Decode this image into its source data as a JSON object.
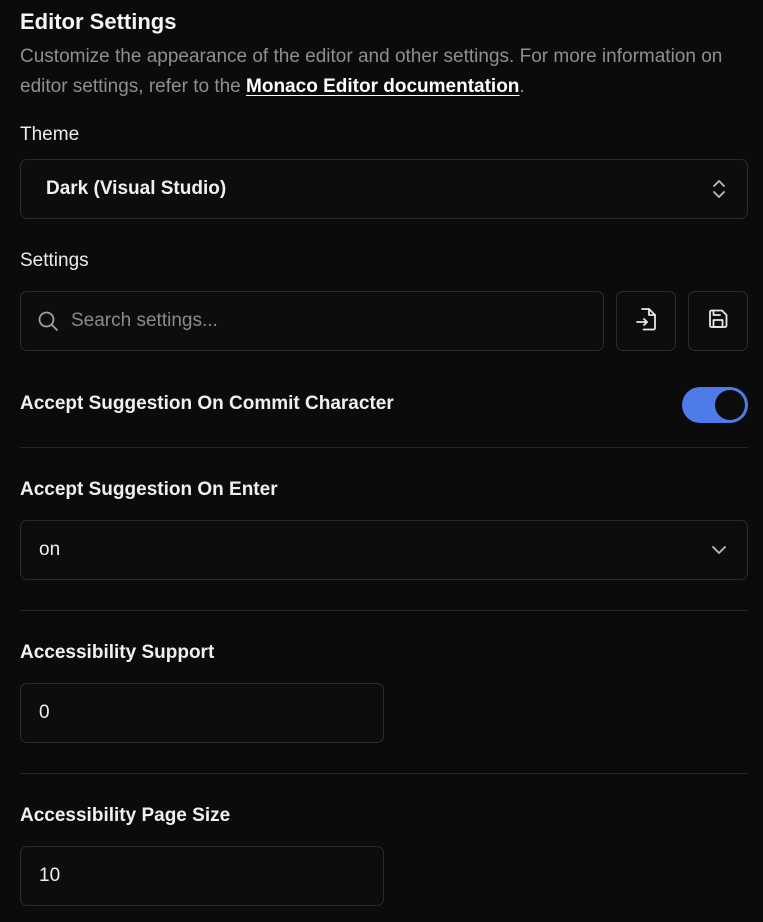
{
  "header": {
    "title": "Editor Settings",
    "description": "Customize the appearance of the editor and other settings. For more information on editor settings, refer to the ",
    "link_text": "Monaco Editor documentation",
    "description_end": "."
  },
  "theme": {
    "label": "Theme",
    "value": "Dark (Visual Studio)",
    "icon": "chevrons-up-down-icon"
  },
  "settings": {
    "label": "Settings",
    "search_placeholder": "Search settings...",
    "search_value": "",
    "import_icon": "file-import-icon",
    "save_icon": "save-icon"
  },
  "options": {
    "accept_on_commit": {
      "label": "Accept Suggestion On Commit Character",
      "enabled": true
    },
    "accept_on_enter": {
      "label": "Accept Suggestion On Enter",
      "value": "on"
    },
    "accessibility_support": {
      "label": "Accessibility Support",
      "value": "0"
    },
    "accessibility_page_size": {
      "label": "Accessibility Page Size",
      "value": "10"
    }
  },
  "colors": {
    "accent": "#4f7be8",
    "background": "#0b0b0b",
    "border": "#2a2a2a"
  }
}
